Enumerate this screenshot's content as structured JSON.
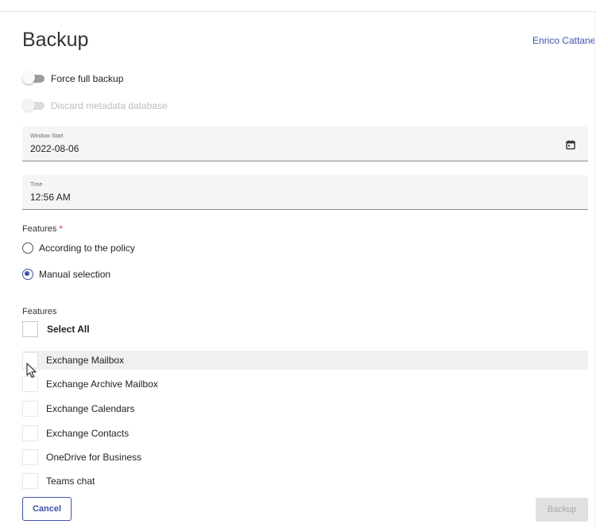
{
  "dialog": {
    "title": "Backup",
    "user_name": "Enrico Cattaneo"
  },
  "toggles": {
    "force_full_backup": {
      "label": "Force full backup",
      "checked": false,
      "disabled": false
    },
    "discard_metadata": {
      "label": "Discard metadata database",
      "checked": false,
      "disabled": true
    }
  },
  "fields": {
    "window_start": {
      "label": "Window Start",
      "value": "2022-08-06",
      "icon": "calendar-icon"
    },
    "time": {
      "label": "Time",
      "value": "12:56 AM"
    }
  },
  "features_mode": {
    "label": "Features",
    "required_marker": "*",
    "options": [
      {
        "label": "According to the policy",
        "checked": false
      },
      {
        "label": "Manual selection",
        "checked": true
      }
    ]
  },
  "features_list": {
    "label": "Features",
    "select_all_label": "Select All",
    "items": [
      {
        "label": "Exchange Mailbox",
        "checked": false,
        "hovered": true
      },
      {
        "label": "Exchange Archive Mailbox",
        "checked": false
      },
      {
        "label": "Exchange Calendars",
        "checked": false
      },
      {
        "label": "Exchange Contacts",
        "checked": false
      },
      {
        "label": "OneDrive for Business",
        "checked": false
      },
      {
        "label": "Teams chat",
        "checked": false
      }
    ]
  },
  "actions": {
    "cancel_label": "Cancel",
    "backup_label": "Backup",
    "backup_disabled": true
  },
  "colors": {
    "accent": "#3f51b5",
    "required": "#d32f2f"
  }
}
